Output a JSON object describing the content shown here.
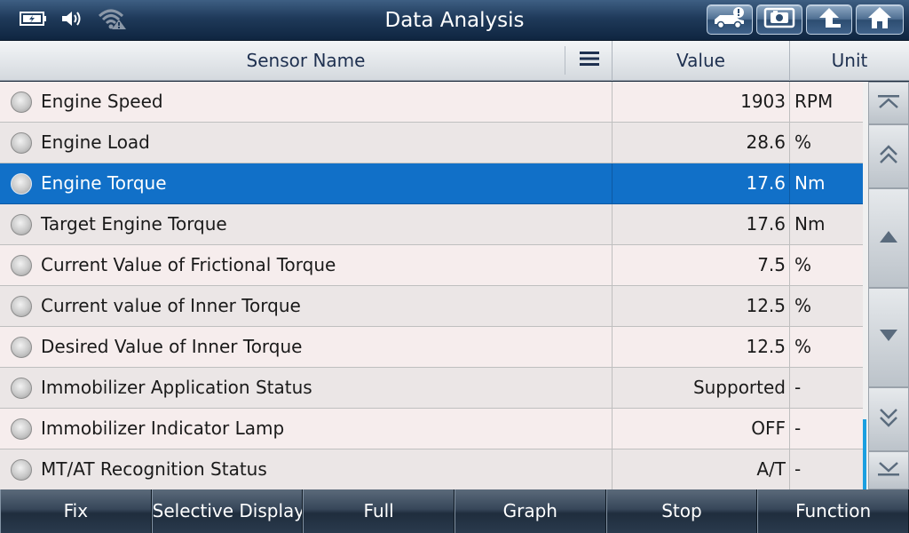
{
  "title": "Data Analysis",
  "status_icons": [
    "battery-icon",
    "speaker-icon",
    "wifi-warning-icon"
  ],
  "toolbar_buttons": [
    "vehicle-info-icon",
    "screenshot-icon",
    "back-icon",
    "home-icon"
  ],
  "table": {
    "headers": {
      "name": "Sensor Name",
      "value": "Value",
      "unit": "Unit"
    },
    "selected_row": 2,
    "rows": [
      {
        "name": "Engine Speed",
        "value": "1903",
        "unit": "RPM"
      },
      {
        "name": "Engine Load",
        "value": "28.6",
        "unit": "%"
      },
      {
        "name": "Engine Torque",
        "value": "17.6",
        "unit": "Nm"
      },
      {
        "name": "Target Engine Torque",
        "value": "17.6",
        "unit": "Nm"
      },
      {
        "name": "Current Value of Frictional Torque",
        "value": "7.5",
        "unit": "%"
      },
      {
        "name": "Current value of Inner Torque",
        "value": "12.5",
        "unit": "%"
      },
      {
        "name": "Desired Value of Inner Torque",
        "value": "12.5",
        "unit": "%"
      },
      {
        "name": "Immobilizer Application Status",
        "value": "Supported",
        "unit": "-"
      },
      {
        "name": "Immobilizer Indicator Lamp",
        "value": "OFF",
        "unit": "-"
      },
      {
        "name": "MT/AT Recognition Status",
        "value": "A/T",
        "unit": "-"
      }
    ]
  },
  "scroll_buttons": [
    "scroll-top-icon",
    "page-up-icon",
    "line-up-icon",
    "line-down-icon",
    "page-down-icon",
    "scroll-bottom-icon"
  ],
  "bottom_buttons": [
    "Fix",
    "Selective Display",
    "Full",
    "Graph",
    "Stop",
    "Function"
  ],
  "colors": {
    "selected_row": "#1170c8",
    "header_text": "#1e3050",
    "scroll_thumb": "#1a9fe0"
  }
}
